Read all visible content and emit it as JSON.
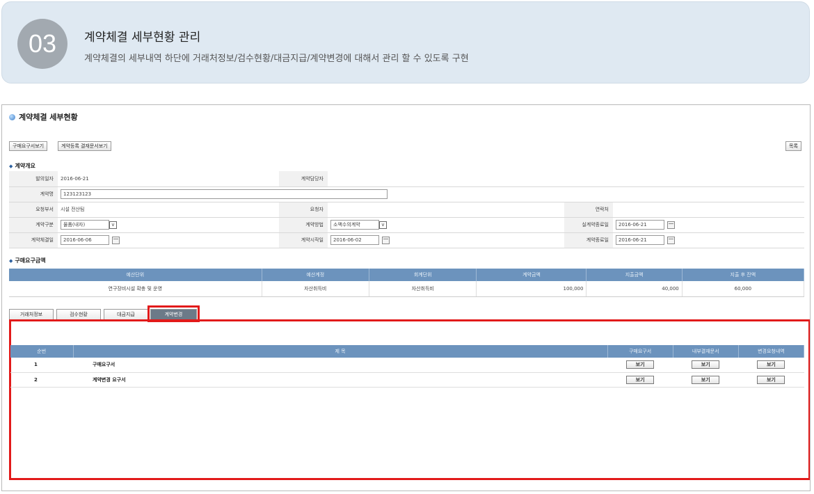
{
  "header": {
    "number": "03",
    "title": "계약체결 세부현황 관리",
    "description": "계약체결의 세부내역 하단에 거래처정보/검수현황/대금지급/계약변경에 대해서 관리 할 수 있도록 구현"
  },
  "screen": {
    "page_title": "계약체결 세부현황",
    "buttons": {
      "request_view": "구매요구서보기",
      "approval_view": "계약등록 결재문서보기",
      "list": "목록"
    },
    "overview": {
      "section_title": "계약개요",
      "labels": {
        "date": "발의일자",
        "manager": "계약담당자",
        "name": "계약명",
        "dept": "요청부서",
        "requester": "요청자",
        "contact": "연락처",
        "type": "계약구분",
        "method": "계약방법",
        "actual_end": "실계약종료일",
        "sign_date": "계약체결일",
        "start_date": "계약시작일",
        "end_date": "계약종료일"
      },
      "values": {
        "date": "2016-06-21",
        "manager": "",
        "name": "123123123",
        "dept": "시설 전산팀",
        "requester": "",
        "contact": "",
        "type": "물품(내자)",
        "method": "소액수의계약",
        "actual_end": "2016-06-21",
        "sign_date": "2016-06-06",
        "start_date": "2016-06-02",
        "end_date": "2016-06-21"
      }
    },
    "budget": {
      "section_title": "구매요구금액",
      "headers": [
        "예산단위",
        "예산계정",
        "회계단위",
        "계약금액",
        "지출금액",
        "지출 후 잔액"
      ],
      "row": [
        "연구장비시설 확충 및 운영",
        "자산취득비",
        "자산취득비",
        "100,000",
        "40,000",
        "60,000"
      ]
    },
    "tabs": [
      "거래처정보",
      "검수현황",
      "대금지급",
      "계약변경"
    ],
    "change_list": {
      "headers": [
        "순번",
        "제 목",
        "구매요구서",
        "내부결재문서",
        "변경요청내역"
      ],
      "rows": [
        {
          "no": "1",
          "title": "구매요구서"
        },
        {
          "no": "2",
          "title": "계약변경 요구서"
        }
      ],
      "view_label": "보기"
    }
  }
}
